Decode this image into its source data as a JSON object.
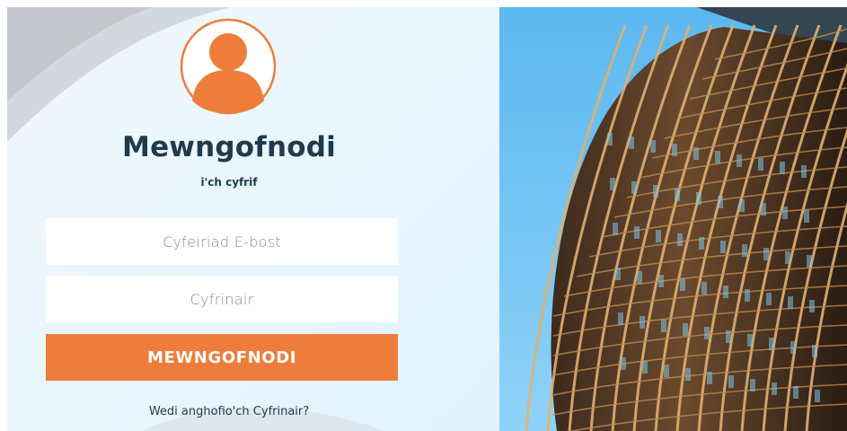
{
  "login": {
    "title": "Mewngofnodi",
    "subtitle": "i'ch cyfrif",
    "email_placeholder": "Cyfeiriad E-bost",
    "password_placeholder": "Cyfrinair",
    "submit_label": "MEWNGOFNODI",
    "forgot_link": "Wedi anghofio'ch Cyfrinair?"
  },
  "icons": {
    "avatar": "user-avatar-icon"
  },
  "colors": {
    "accent": "#EE7D3B",
    "heading": "#1E3A4C",
    "sky": "#74C4F4"
  }
}
